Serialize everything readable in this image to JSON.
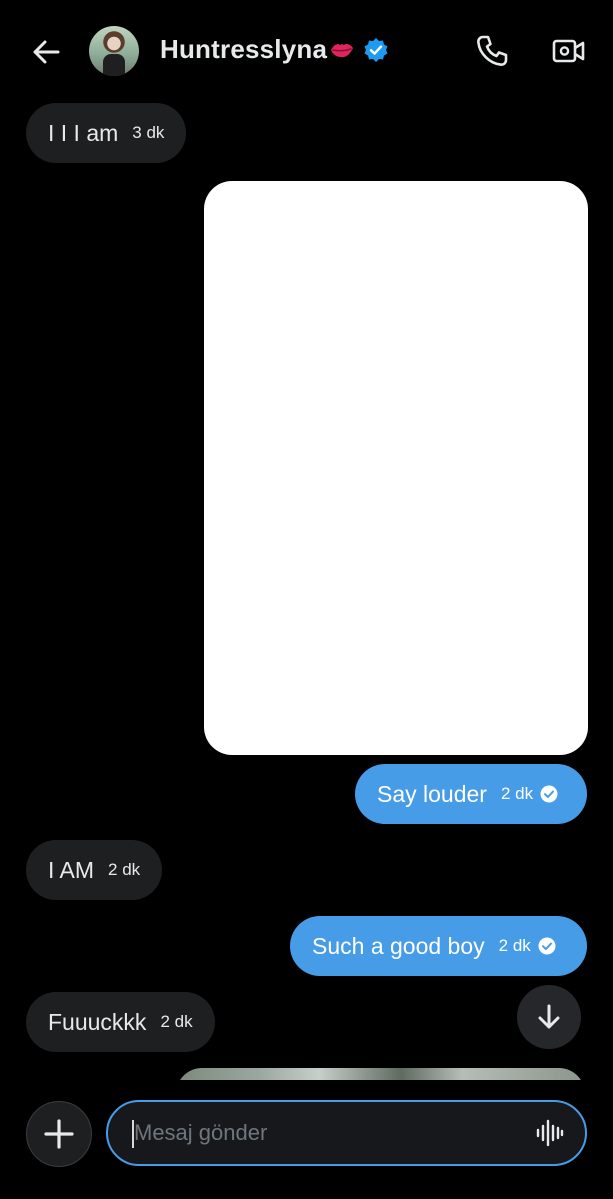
{
  "header": {
    "contact_name": "Huntresslyna",
    "back_icon": "arrow-left-icon",
    "name_emoji_icon": "kiss-lips-icon",
    "verified_icon": "verified-badge-icon",
    "call_icon": "phone-icon",
    "video_icon": "video-camera-icon"
  },
  "messages": [
    {
      "direction": "incoming",
      "text": "I I I am",
      "time": "3 dk"
    },
    {
      "direction": "outgoing",
      "type": "media"
    },
    {
      "direction": "outgoing",
      "text": "Say louder",
      "time": "2 dk",
      "status_icon": "read-check-icon"
    },
    {
      "direction": "incoming",
      "text": "I AM",
      "time": "2 dk"
    },
    {
      "direction": "outgoing",
      "text": "Such a good boy",
      "time": "2 dk",
      "status_icon": "read-check-icon"
    },
    {
      "direction": "incoming",
      "text": "Fuuuckkk",
      "time": "2 dk"
    },
    {
      "direction": "outgoing",
      "type": "media"
    }
  ],
  "scroll_down_icon": "arrow-down-icon",
  "composer": {
    "add_icon": "plus-icon",
    "placeholder": "Mesaj gönder",
    "value": "",
    "voice_icon": "voice-waveform-icon"
  },
  "colors": {
    "background": "#000000",
    "incoming_bubble": "#1e1f21",
    "outgoing_bubble": "#479ce8",
    "verified_blue": "#1d9bf0",
    "input_border": "#479ce8"
  }
}
